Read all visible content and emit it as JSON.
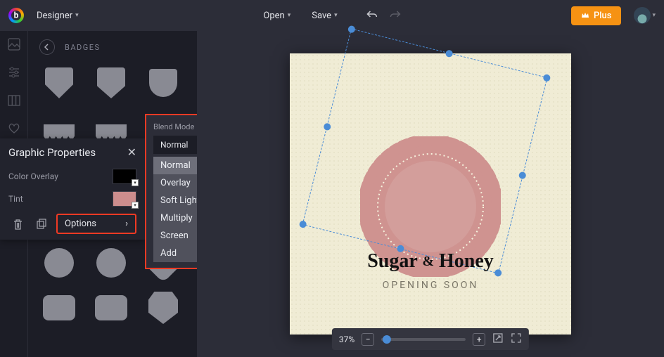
{
  "topbar": {
    "mode_label": "Designer",
    "open_label": "Open",
    "save_label": "Save",
    "plus_label": "Plus"
  },
  "panel": {
    "title": "BADGES"
  },
  "properties": {
    "title": "Graphic Properties",
    "color_overlay_label": "Color Overlay",
    "tint_label": "Tint",
    "options_label": "Options",
    "color_overlay_value": "#000000",
    "tint_value": "#cc8d8d"
  },
  "blend": {
    "label": "Blend Mode",
    "selected": "Normal",
    "options": [
      "Normal",
      "Overlay",
      "Soft Light",
      "Multiply",
      "Screen",
      "Add"
    ]
  },
  "canvas": {
    "headline_a": "Sugar",
    "headline_amp": "&",
    "headline_b": "Honey",
    "subhead": "OPENING SOON"
  },
  "zoom": {
    "percent": "37%"
  }
}
